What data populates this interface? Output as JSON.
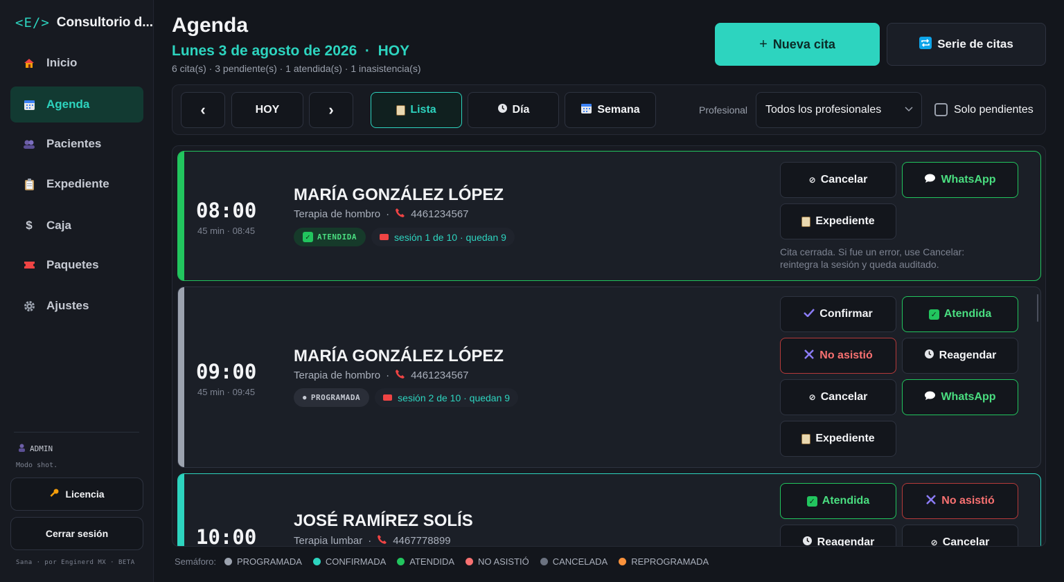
{
  "sidebar": {
    "brand_logo": "<E/>",
    "brand_name": "Consultorio d...",
    "items": [
      {
        "label": "Inicio",
        "icon": "house-icon"
      },
      {
        "label": "Agenda",
        "icon": "calendar-icon"
      },
      {
        "label": "Pacientes",
        "icon": "users-icon"
      },
      {
        "label": "Expediente",
        "icon": "clipboard-icon"
      },
      {
        "label": "Caja",
        "icon": "dollar-icon"
      },
      {
        "label": "Paquetes",
        "icon": "ticket-icon"
      },
      {
        "label": "Ajustes",
        "icon": "gear-icon"
      }
    ],
    "user_role": "ADMIN",
    "mode_note": "Modo shot.",
    "license_label": "Licencia",
    "logout_label": "Cerrar sesión",
    "footer": "Sana · por Enginerd MX · BETA"
  },
  "header": {
    "title": "Agenda",
    "date_line": "Lunes 3 de agosto de 2026  ·  HOY",
    "summary": "6 cita(s) · 3 pendiente(s) · 1 atendida(s) · 1 inasistencia(s)",
    "new_label": "Nueva cita",
    "new_prefix": "+",
    "series_label": "Serie de citas"
  },
  "toolbar": {
    "prev": "‹",
    "today": "HOY",
    "next": "›",
    "view_list": "Lista",
    "view_day": "Día",
    "view_week": "Semana",
    "prof_label": "Profesional",
    "prof_value": "Todos los profesionales",
    "only_pending": "Solo pendientes"
  },
  "appointments": [
    {
      "time": "08:00",
      "duration": "45 min · 08:45",
      "name": "MARÍA GONZÁLEZ LÓPEZ",
      "service": "Terapia de hombro",
      "phone": "4461234567",
      "status": "ATENDIDA",
      "session": "sesión 1 de 10 · quedan 9",
      "actions": {
        "cancel": "Cancelar",
        "whatsapp": "WhatsApp",
        "record": "Expediente"
      },
      "note": "Cita cerrada. Si fue un error, use Cancelar: reintegra la sesión y queda auditado."
    },
    {
      "time": "09:00",
      "duration": "45 min · 09:45",
      "name": "MARÍA GONZÁLEZ LÓPEZ",
      "service": "Terapia de hombro",
      "phone": "4461234567",
      "status": "PROGRAMADA",
      "session": "sesión 2 de 10 · quedan 9",
      "actions": {
        "confirm": "Confirmar",
        "attended": "Atendida",
        "noshow": "No asistió",
        "reschedule": "Reagendar",
        "cancel": "Cancelar",
        "whatsapp": "WhatsApp",
        "record": "Expediente"
      }
    },
    {
      "time": "10:00",
      "name": "JOSÉ RAMÍREZ SOLÍS",
      "service": "Terapia lumbar",
      "phone": "4467778899",
      "actions": {
        "attended": "Atendida",
        "noshow": "No asistió",
        "reschedule": "Reagendar",
        "cancel": "Cancelar"
      }
    }
  ],
  "legend": {
    "label": "Semáforo:",
    "items": [
      {
        "label": "PROGRAMADA",
        "color": "#9ca3af"
      },
      {
        "label": "CONFIRMADA",
        "color": "#2dd4bf"
      },
      {
        "label": "ATENDIDA",
        "color": "#22c55e"
      },
      {
        "label": "NO ASISTIÓ",
        "color": "#f87171"
      },
      {
        "label": "CANCELADA",
        "color": "#6b7280"
      },
      {
        "label": "REPROGRAMADA",
        "color": "#fb923c"
      }
    ]
  },
  "colors": {
    "accent": "#2dd4bf",
    "success": "#22c55e",
    "danger": "#f87171",
    "background": "#13161c"
  }
}
